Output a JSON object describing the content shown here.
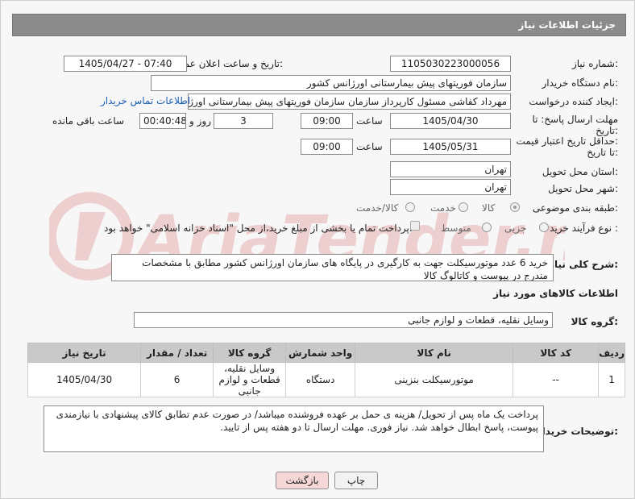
{
  "header": {
    "title": "جزئیات اطلاعات نیاز"
  },
  "fields": {
    "need_number_label": "شماره نیاز:",
    "need_number": "1105030223000056",
    "announce_label": "تاریخ و ساعت اعلان عمومی:",
    "announce_value": "1405/04/27 - 07:40",
    "buyer_org_label": "نام دستگاه خریدار:",
    "buyer_org": "سازمان فوریتهای پیش بیمارستانی اورژانس کشور",
    "creator_label": "ایجاد کننده درخواست:",
    "creator": "مهرداد کفاشی مسئول کارپرداز سازمان سازمان فوریتهای پیش بیمارستانی اورژانس کشور",
    "contact_link": "اطلاعات تماس خریدار",
    "deadline_label_1": "مهلت ارسال پاسخ: تا",
    "deadline_label_2": "تاریخ:",
    "deadline_date": "1405/04/30",
    "time_word": "ساعت",
    "deadline_time": "09:00",
    "days_value": "3",
    "days_word": "روز و",
    "remaining_time": "00:40:48",
    "remaining_word": "ساعت باقی مانده",
    "price_label_1": "حداقل تاریخ اعتبار قیمت:",
    "price_label_2": "تا تاریخ:",
    "price_date": "1405/05/31",
    "price_time": "09:00",
    "province_label": "استان محل تحویل:",
    "province": "تهران",
    "city_label": "شهر محل تحویل:",
    "city": "تهران",
    "category_label": "طبقه بندی موضوعی:",
    "category_options": [
      "کالا",
      "خدمت",
      "کالا/خدمت"
    ],
    "process_label": "نوع فرآیند خرید :",
    "process_options": [
      "جزیی",
      "متوسط"
    ],
    "process_note": "پرداخت تمام یا بخشی از مبلغ خرید،از محل \"اسناد خزانه اسلامی\" خواهد بود."
  },
  "description": {
    "label": "شرح کلی نیاز:",
    "text": "خرید 6 عدد موتورسیکلت جهت به کارگیری در پایگاه های سازمان اورژانس کشور مطابق با مشخصات مندرج در پیوست و کاتالوگ کالا"
  },
  "goods_section": {
    "title": "اطلاعات کالاهای مورد نیاز",
    "group_label": "گروه کالا:",
    "group_value": "وسایل نقلیه، قطعات و لوازم جانبی"
  },
  "table": {
    "headers": [
      "ردیف",
      "کد کالا",
      "نام کالا",
      "واحد شمارش",
      "گروه کالا",
      "تعداد / مقدار",
      "تاریخ نیاز"
    ],
    "rows": [
      [
        "1",
        "--",
        "موتورسیکلت بنزینی",
        "دستگاه",
        "وسایل نقلیه، قطعات و لوازم جانبی",
        "6",
        "1405/04/30"
      ]
    ]
  },
  "buyer_notes": {
    "label": "توضیحات خریدار:",
    "text": "پرداخت یک ماه پس از تحویل/ هزینه ی حمل بر عهده فروشنده میباشد/ در صورت عدم تطابق کالای پیشنهادی با نیازمندی پیوست، پاسخ ابطال خواهد شد. نیاز فوری. مهلت ارسال تا دو هفته پس از تایید."
  },
  "buttons": {
    "print": "چاپ",
    "back": "بازگشت"
  },
  "watermark": {
    "text": "AriaTender.net"
  },
  "colors": {
    "header_bg": "#8b8b8b",
    "link": "#1a5fb4",
    "back_btn_bg": "#f6d7d7",
    "table_header_bg": "#c9c9c9"
  }
}
